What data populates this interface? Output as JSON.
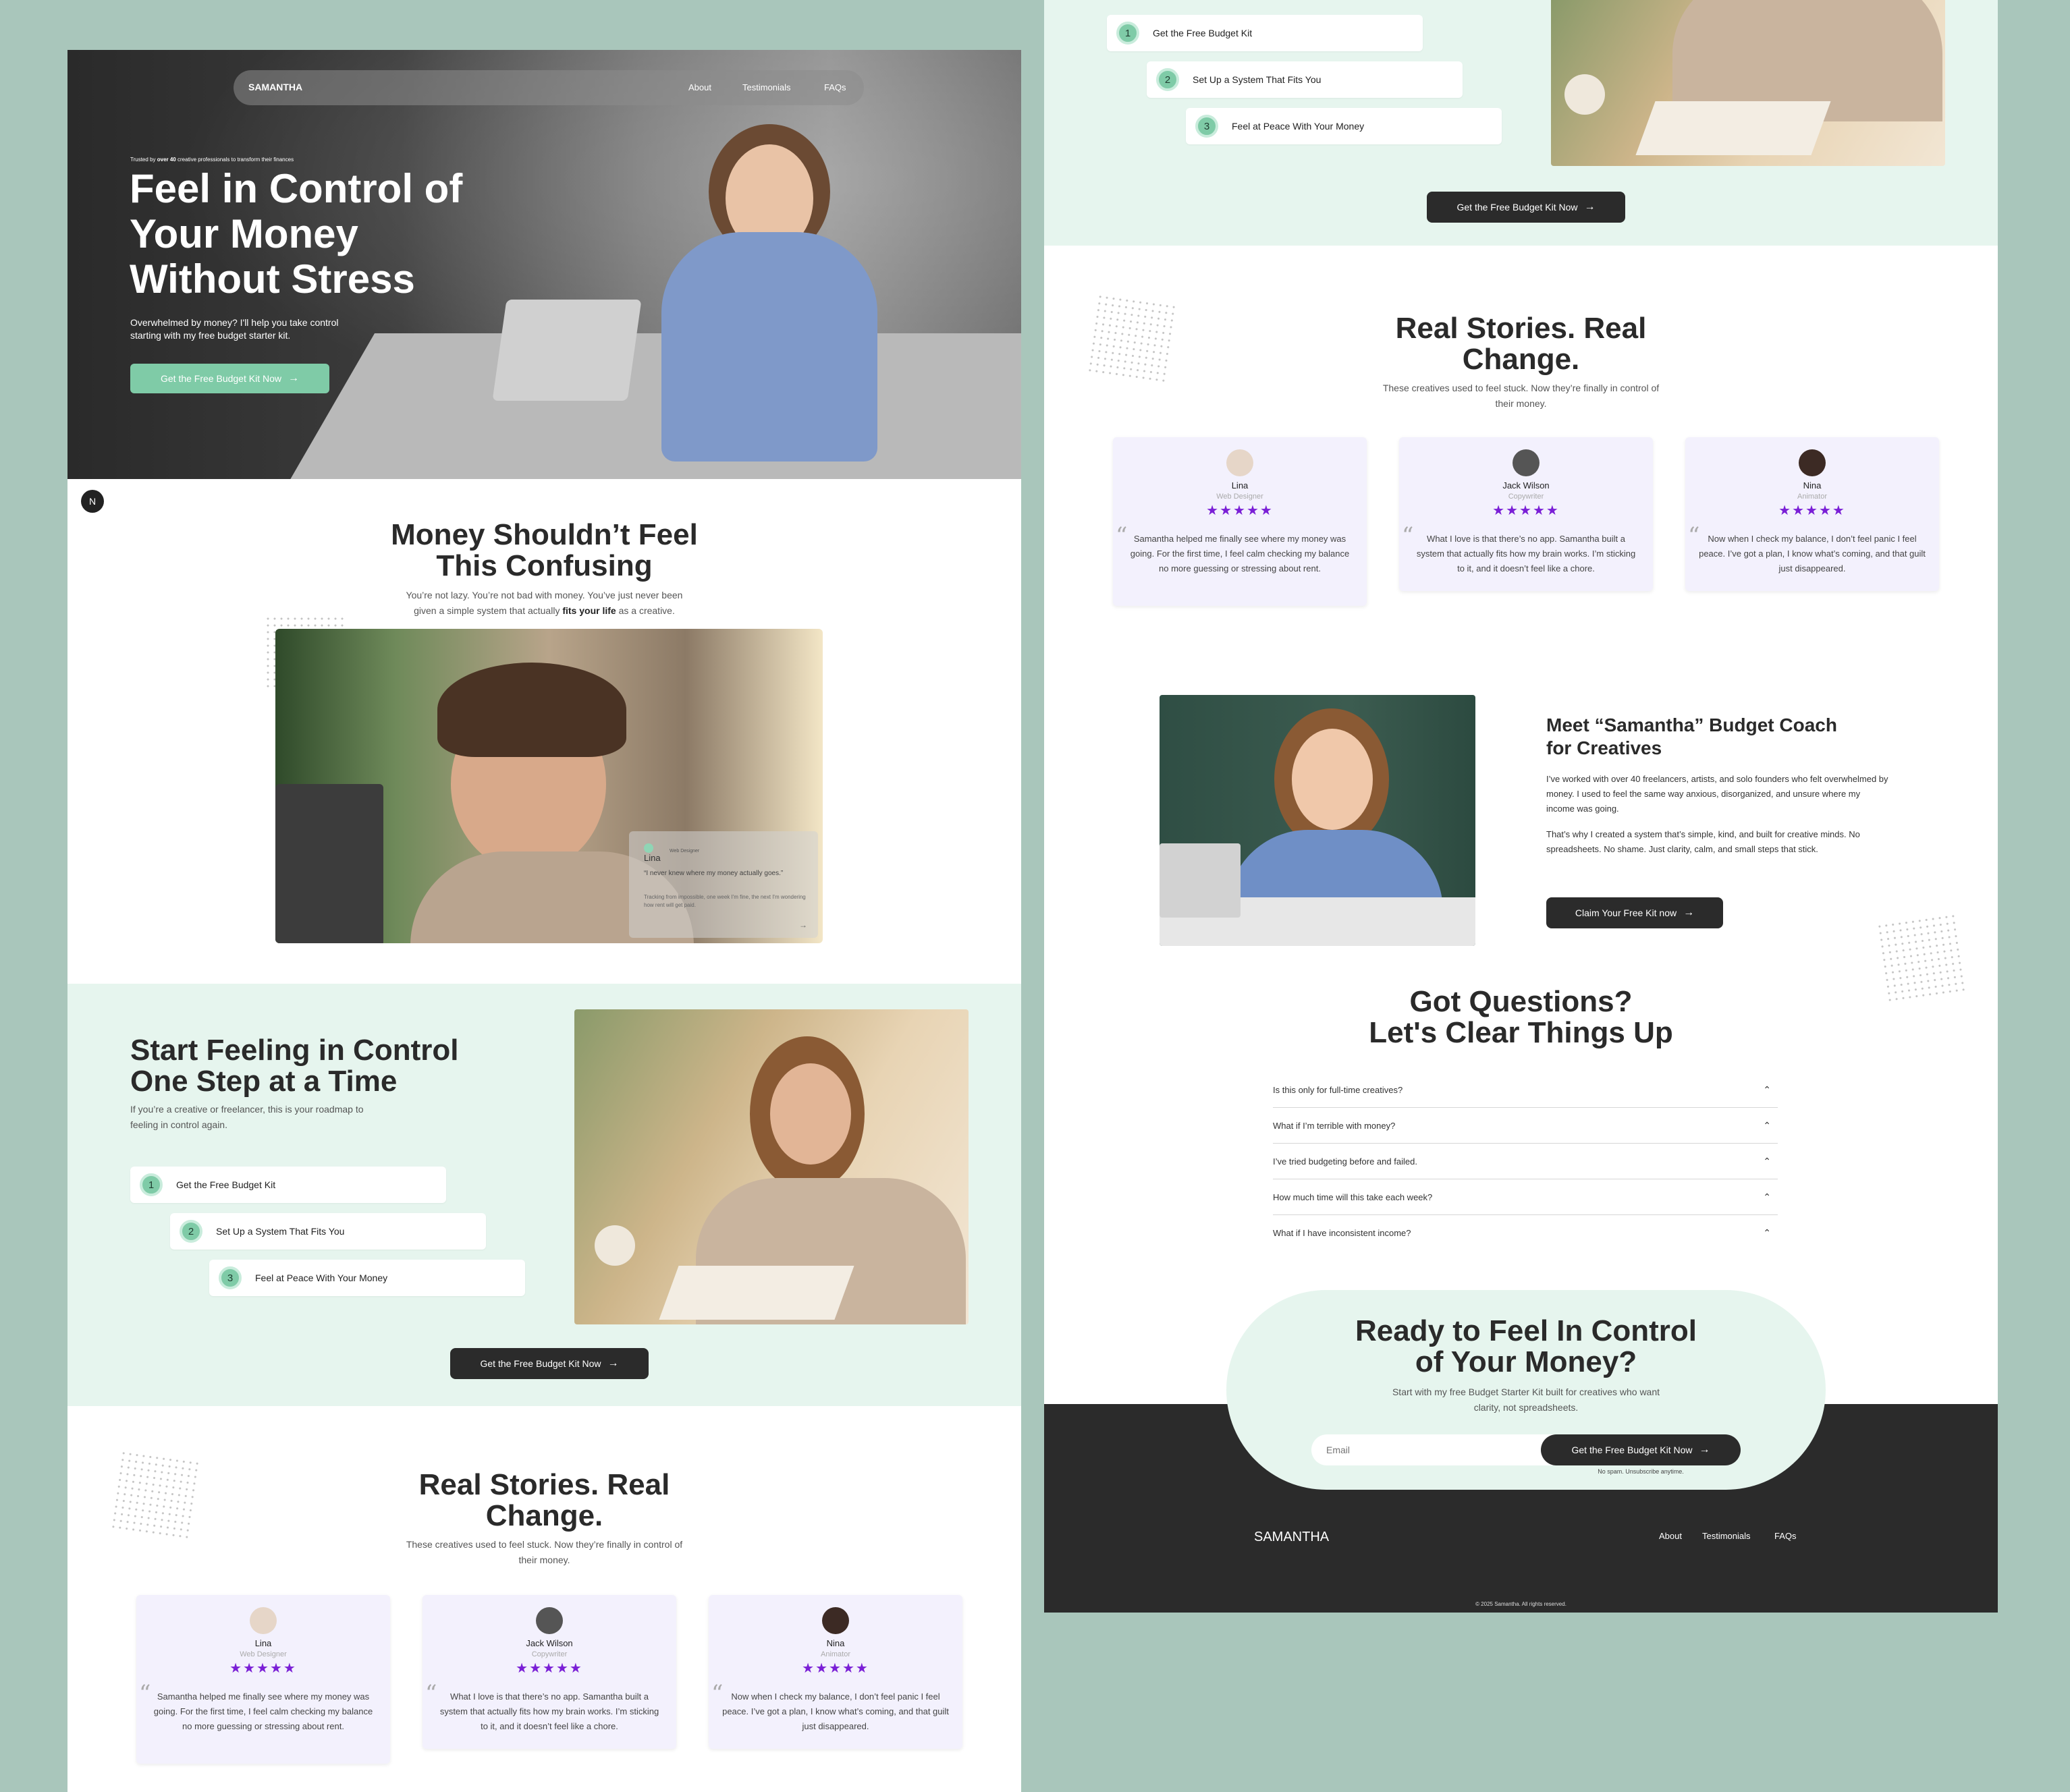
{
  "hero": {
    "brand": "SAMANTHA",
    "nav": [
      "About",
      "Testimonials",
      "FAQs"
    ],
    "trusted_pre": "Trusted by",
    "trusted_bold": "over 40",
    "trusted_post": "creative professionals to transform their finances",
    "title_l1": "Feel in Control of",
    "title_l2": "Your Money",
    "title_l3": "Without Stress",
    "subtitle_l1": "Overwhelmed by money? I'll help you take control",
    "subtitle_l2": "starting with my free budget starter kit.",
    "cta": "Get the Free Budget Kit Now",
    "badge": "N"
  },
  "problem": {
    "title_l1": "Money Shouldn’t Feel",
    "title_l2": "This Confusing",
    "sub_l1": "You’re not lazy. You’re not bad with money. You’ve just never been",
    "sub_l2_pre": "given a simple system that actually",
    "sub_l2_bold": "fits your life",
    "sub_l2_post": "as a creative.",
    "overlay": {
      "name": "Lina",
      "role": "Web Designer",
      "quote": "“I never knew where my money actually goes.”",
      "detail": "Tracking from impossible, one week I'm fine, the next I'm wondering how rent will get paid."
    }
  },
  "steps_section": {
    "title_l1": "Start Feeling in Control",
    "title_l2": "One Step at a Time",
    "sub_l1": "If you’re a creative or freelancer, this is your roadmap to",
    "sub_l2": "feeling in control again.",
    "steps": [
      {
        "num": "1",
        "label": "Get the Free Budget Kit"
      },
      {
        "num": "2",
        "label": "Set Up a System That Fits You"
      },
      {
        "num": "3",
        "label": "Feel at Peace With Your Money"
      }
    ],
    "cta": "Get the Free Budget Kit Now"
  },
  "testimonials": {
    "title_l1": "Real Stories. Real",
    "title_l2": "Change.",
    "sub_l1": "These creatives used to feel stuck. Now they’re finally in control of",
    "sub_l2": "their money.",
    "cards": [
      {
        "name": "Lina",
        "role": "Web Designer",
        "stars": "★★★★★",
        "quote": "Samantha helped me finally see where my money was going. For the first time, I feel calm checking my balance no more guessing or stressing about rent."
      },
      {
        "name": "Jack Wilson",
        "role": "Copywriter",
        "stars": "★★★★★",
        "quote": "What I love is that there’s no app. Samantha built a system that actually fits how my brain works. I’m sticking to it, and it doesn’t feel like a chore."
      },
      {
        "name": "Nina",
        "role": "Animator",
        "stars": "★★★★★",
        "quote": "Now when I check my balance, I don’t feel panic I feel peace. I’ve got a plan, I know what’s coming, and that guilt just disappeared."
      }
    ]
  },
  "about": {
    "title_l1": "Meet “Samantha” Budget Coach",
    "title_l2": "for Creatives",
    "p1": "I’ve worked with over 40 freelancers, artists, and solo founders who felt overwhelmed by money. I used to feel the same way anxious, disorganized, and unsure where my income was going.",
    "p2": "That’s why I created a system that’s simple, kind, and built for creative minds. No spreadsheets. No shame. Just clarity, calm, and small steps that stick.",
    "cta": "Claim Your Free Kit now"
  },
  "faq": {
    "title_l1": "Got Questions?",
    "title_l2": "Let's Clear Things Up",
    "items": [
      "Is this only for full-time creatives?",
      "What if I’m terrible with money?",
      "I’ve tried budgeting before and failed.",
      "How much time will this take each week?",
      "What if I have inconsistent income?"
    ]
  },
  "cta_block": {
    "title_l1": "Ready to Feel In Control",
    "title_l2": "of Your Money?",
    "sub_l1": "Start with my free Budget Starter Kit built for creatives who want",
    "sub_l2": "clarity, not spreadsheets.",
    "email_placeholder": "Email",
    "button": "Get the Free Budget Kit Now",
    "note": "No spam. Unsubscribe anytime."
  },
  "footer": {
    "brand": "SAMANTHA",
    "nav": [
      "About",
      "Testimonials",
      "FAQs"
    ],
    "copyright": "© 2025 Samantha. All rights reserved."
  },
  "colors": {
    "page_bg": "#a9c6bb",
    "mint": "#e6f5ee",
    "accent_green": "#7fcba7",
    "dark": "#2b2b2b",
    "card": "#f3f1fd",
    "star": "#7a1fd6"
  }
}
